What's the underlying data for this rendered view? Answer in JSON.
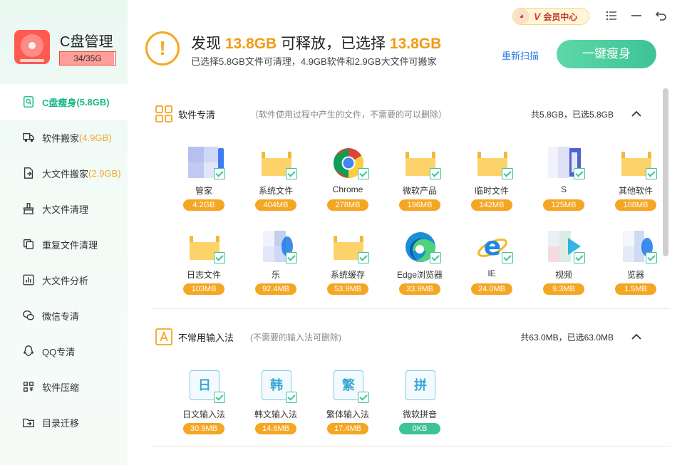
{
  "app": {
    "title": "C盘管理",
    "usage_text": "34/35G",
    "usage_fraction": 0.97
  },
  "sidebar": {
    "items": [
      {
        "label": "C盘瘦身",
        "extra": "(5.8GB)",
        "icon": "broom-icon",
        "active": true
      },
      {
        "label": "软件搬家",
        "extra": "(4.9GB)",
        "icon": "truck-icon"
      },
      {
        "label": "大文件搬家",
        "extra": "(2.9GB)",
        "icon": "file-move-icon"
      },
      {
        "label": "大文件清理",
        "extra": "",
        "icon": "brush-icon"
      },
      {
        "label": "重复文件清理",
        "extra": "",
        "icon": "copy-icon"
      },
      {
        "label": "大文件分析",
        "extra": "",
        "icon": "chart-icon"
      },
      {
        "label": "微信专清",
        "extra": "",
        "icon": "wechat-icon"
      },
      {
        "label": "QQ专清",
        "extra": "",
        "icon": "qq-icon"
      },
      {
        "label": "软件压缩",
        "extra": "",
        "icon": "grid-icon"
      },
      {
        "label": "目录迁移",
        "extra": "",
        "icon": "folder-move-icon"
      }
    ]
  },
  "header": {
    "headline_prefix": "发现",
    "found_size": "13.8GB",
    "headline_mid": "可释放，已选择",
    "selected_size": "13.8GB",
    "subline": "已选择5.8GB文件可清理，4.9GB软件和2.9GB大文件可搬家",
    "rescan_label": "重新扫描",
    "slim_button": "一键瘦身",
    "vip_mark": "V",
    "vip_label": "会员中心"
  },
  "sections": [
    {
      "title": "软件专清",
      "desc": "（软件使用过程中产生的文件，不需要的可以删除）",
      "total": "共5.8GB，已选5.8GB",
      "items": [
        {
          "name": "管家",
          "size": "4.2GB"
        },
        {
          "name": "系统文件",
          "size": "404MB"
        },
        {
          "name": "Chrome",
          "size": "278MB"
        },
        {
          "name": "微软产品",
          "size": "196MB"
        },
        {
          "name": "临时文件",
          "size": "142MB"
        },
        {
          "name": "S",
          "size": "125MB"
        },
        {
          "name": "其他软件",
          "size": "108MB"
        },
        {
          "name": "日志文件",
          "size": "103MB"
        },
        {
          "name": "乐",
          "size": "92.4MB"
        },
        {
          "name": "系统缓存",
          "size": "53.9MB"
        },
        {
          "name": "Edge浏览器",
          "size": "33.9MB"
        },
        {
          "name": "IE",
          "size": "24.0MB"
        },
        {
          "name": "视频",
          "size": "9.3MB"
        },
        {
          "name": "览器",
          "size": "1.5MB"
        }
      ]
    },
    {
      "title": "不常用输入法",
      "desc": "(不需要的输入法可删除)",
      "total": "共63.0MB，已选63.0MB",
      "items": [
        {
          "name": "日文输入法",
          "size": "30.9MB",
          "glyph": "日"
        },
        {
          "name": "韩文输入法",
          "size": "14.6MB",
          "glyph": "韩"
        },
        {
          "name": "繁体输入法",
          "size": "17.4MB",
          "glyph": "繁"
        },
        {
          "name": "微软拼音",
          "size": "0KB",
          "glyph": "拼"
        }
      ]
    }
  ],
  "colors": {
    "accent_green": "#3ec396",
    "accent_orange": "#f5a623",
    "headline_orange": "#f29b12",
    "link_blue": "#2d7fe3"
  }
}
